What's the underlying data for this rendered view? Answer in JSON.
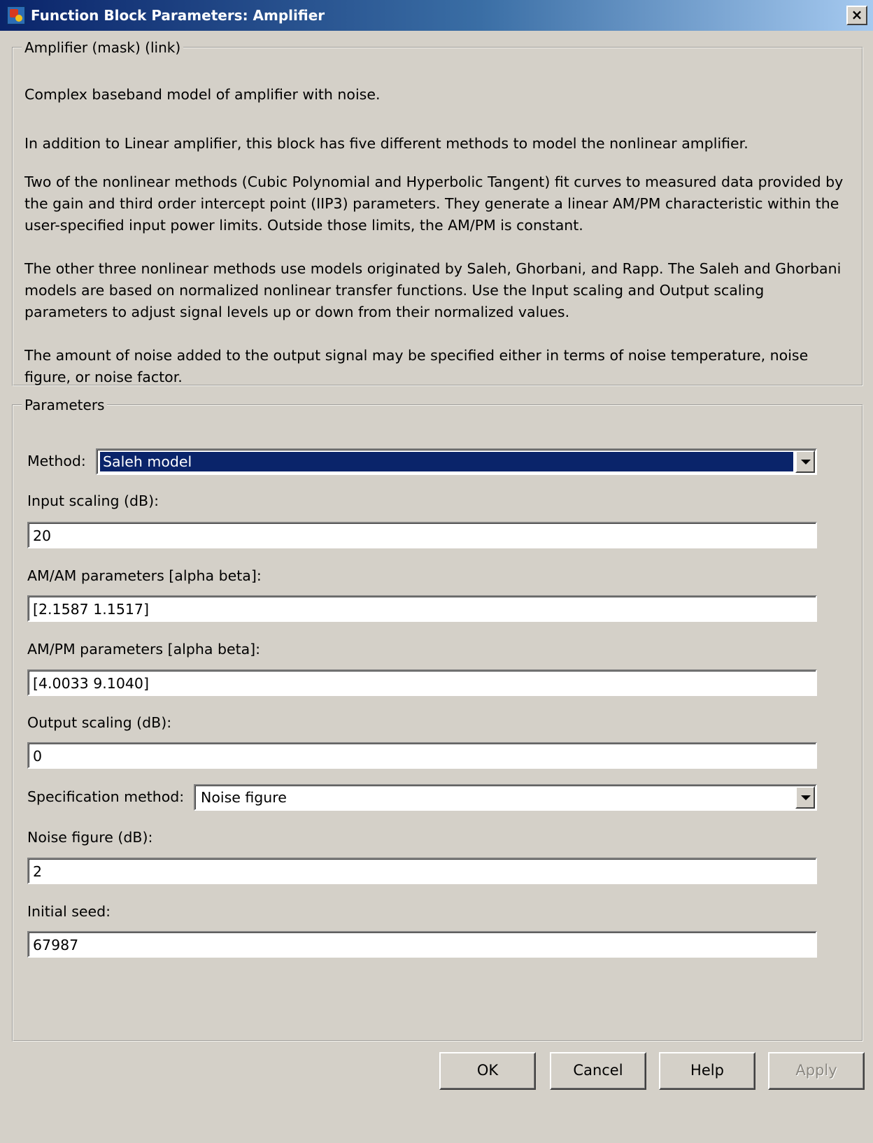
{
  "window": {
    "title": "Function Block Parameters: Amplifier",
    "close_label": "×"
  },
  "description": {
    "legend": "Amplifier (mask) (link)",
    "paragraphs": [
      "Complex baseband model of amplifier with noise.",
      "In addition to Linear amplifier, this block has five different methods to model the nonlinear amplifier.",
      "Two of the nonlinear methods (Cubic Polynomial and Hyperbolic Tangent) fit curves to measured data provided by the gain and third order intercept point (IIP3) parameters. They generate a linear AM/PM characteristic within the user-specified input power limits.  Outside those limits, the AM/PM is constant.",
      "The other three nonlinear methods use models originated by Saleh, Ghorbani, and Rapp.  The Saleh and Ghorbani models are based on normalized nonlinear transfer functions.  Use the Input scaling and Output scaling parameters to adjust signal levels up or down from their normalized values.",
      "The amount of noise added to the output signal may be specified either in terms of noise temperature, noise figure, or noise factor."
    ]
  },
  "parameters": {
    "legend": "Parameters",
    "method_label": "Method:",
    "method_value": "Saleh model",
    "input_scaling_label": "Input scaling (dB):",
    "input_scaling_value": "20",
    "amam_label": "AM/AM parameters [alpha beta]:",
    "amam_value": "[2.1587 1.1517]",
    "ampm_label": "AM/PM parameters [alpha beta]:",
    "ampm_value": "[4.0033 9.1040]",
    "output_scaling_label": "Output scaling (dB):",
    "output_scaling_value": "0",
    "spec_method_label": "Specification method:",
    "spec_method_value": "Noise figure",
    "noise_figure_label": "Noise figure (dB):",
    "noise_figure_value": "2",
    "seed_label": "Initial seed:",
    "seed_value": "67987"
  },
  "buttons": {
    "ok": "OK",
    "cancel": "Cancel",
    "help": "Help",
    "apply": "Apply"
  }
}
